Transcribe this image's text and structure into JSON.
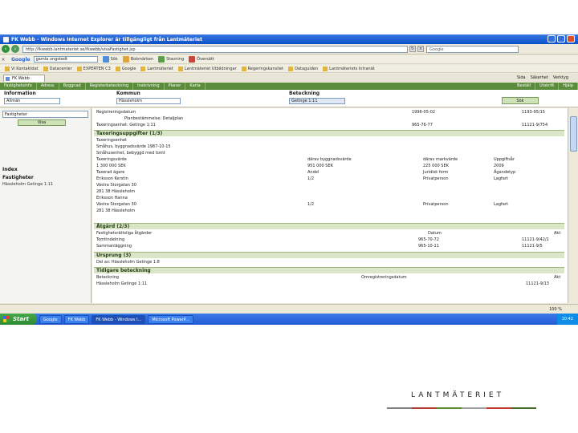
{
  "window": {
    "title": "FK Webb - Windows Internet Explorer är tillgängligt från Lantmäteriet"
  },
  "addressbar": {
    "url": "http://fkwebb.lantmateriet.se/fkwebb/visaFastighet.jsp",
    "search_placeholder": "Google"
  },
  "google_toolbar": {
    "logo": "Google",
    "query": "gamla ungstedt",
    "items": [
      "Sök",
      "Bokmärken",
      "Stavning",
      "Översätt"
    ]
  },
  "favorites": {
    "items": [
      "Vi Kontaktdat",
      "Datacenter",
      "EXPERTEN C3",
      "Google",
      "Lantmäteriet",
      "Lantmäteriet Utbildningar",
      "Regeringskansliet",
      "Dataguiden",
      "Lantmäteriets Intranät"
    ]
  },
  "tabs": {
    "active": "FK Webb",
    "ie_tools": [
      "Sida",
      "Säkerhet",
      "Verktyg"
    ]
  },
  "appnav": {
    "items": [
      "Fastighetsinfo",
      "Adress",
      "Byggnad",
      "Registerbeteckning",
      "Inskrivning",
      "Planer",
      "Karta"
    ],
    "right": [
      "Beställ",
      "Utskrift",
      "Hjälp"
    ]
  },
  "search": {
    "info_label": "Information",
    "info_value": "Allmän",
    "kommun_label": "Kommun",
    "kommun_value": "Hässleholm",
    "beteckning_label": "Beteckning",
    "beteckning_value": "Getinge 1:11",
    "search_button": "Sök"
  },
  "sidebar": {
    "combo_value": "Fastigheter",
    "visa_button": "Visa",
    "index_label": "Index",
    "fastigheter_label": "Fastigheter",
    "item": "Hässleholm Getinge 1:11"
  },
  "main": {
    "rows": [
      {
        "label": "Registreringsdatum",
        "date": "1996-05-02",
        "ref": "1193-95/15"
      },
      {
        "label": "Planbestämmelse: Detaljplan",
        "date": "",
        "ref": ""
      },
      {
        "label": "Taxeringsenhet: Getinge 1:11",
        "date": "965-76-77",
        "ref": "11121-9/754"
      }
    ],
    "sections": {
      "taxering": "Taxeringsuppgifter (1/3)",
      "atgard": "Åtgärd (2/3)",
      "ursprung": "Ursprung (3)",
      "tidigare": "Tidigare beteckning"
    },
    "taxering_lines": [
      "Taxeringsenhet",
      "Småhus, byggnadsvärde 1987-10-15",
      "Småhusenhet, bebyggd med tomt",
      "Taxeringsvärde",
      "1 300 000 SEK",
      "Taxerad ägare",
      "Eriksson Kerstin",
      "Västra Storgatan 30",
      "281 38 Hässleholm",
      "Eriksson Hanna",
      "Västra Storgatan 30",
      "281 38 Hässleholm"
    ],
    "taxering_cols": {
      "h1": "därav byggnadsvärde",
      "v1": "951 000 SEK",
      "h2": "därav markvärde",
      "v2": "225 000 SEK",
      "h3": "Uppgiftsår",
      "v3": "2009",
      "h4": "Andel",
      "v4": "1/2",
      "h5": "Juridisk form",
      "v5": "Privatperson",
      "h6": "Ägandetyp",
      "v6": "Lagfart",
      "v7": "1/2",
      "v8": "Privatperson",
      "v9": "Lagfart"
    },
    "atgard_rows": {
      "h": "Fastighetsrättsliga åtgärder",
      "col_datum": "Datum",
      "col_akt": "Akt",
      "r1": "Tomtindelning",
      "r1_datum": "965-70-72",
      "r1_akt": "11121-9/42/1",
      "r2": "Sammanläggning",
      "r2_datum": "965-10-11",
      "r2_akt": "11121-9/5"
    },
    "ursprung_row": "Del av: Hässleholm Getinge 1:8",
    "tidigare_rows": {
      "col_bet": "Beteckning",
      "col_omreg": "Omregistreringsdatum",
      "col_akt": "Akt",
      "r1": "Hässleholm Getinge 1:11",
      "r1_akt": "11121-9/13"
    }
  },
  "statusbar": {
    "zoom": "100 %"
  },
  "taskbar": {
    "start": "Start",
    "tasks": [
      "Google",
      "FK Webb",
      "FK Webb - Windows I...",
      "Microsoft PowerP..."
    ],
    "clock": "10:42"
  },
  "branding": {
    "logo_text": "LANTMÄTERIET"
  }
}
